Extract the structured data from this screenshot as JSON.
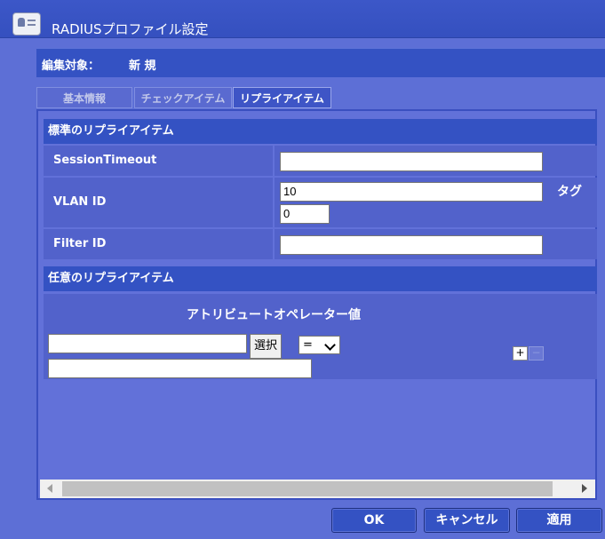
{
  "window": {
    "title": "RADIUSプロファイル設定",
    "icon": "profile-card-icon"
  },
  "edit_target": {
    "label": "編集対象：",
    "value": "新 規"
  },
  "tabs": [
    {
      "label": "基本情報",
      "active": false
    },
    {
      "label": "チェックアイテム",
      "active": false
    },
    {
      "label": "リプライアイテム",
      "active": true
    }
  ],
  "standard_section": {
    "title": "標準のリプライアイテム",
    "rows": [
      {
        "label": "SessionTimeout",
        "value": ""
      },
      {
        "label": "VLAN ID",
        "value": "10",
        "tag_value": "0",
        "tag_label": "タグ"
      },
      {
        "label": "Filter ID",
        "value": ""
      }
    ]
  },
  "optional_section": {
    "title": "任意のリプライアイテム",
    "column_header": "アトリビュートオペレーター値",
    "attribute_value": "",
    "select_button": "選択",
    "operator": "=",
    "value": "",
    "add_button": "+",
    "remove_button": "−"
  },
  "footer": {
    "ok": "OK",
    "cancel": "キャンセル",
    "apply": "適用"
  },
  "colors": {
    "background": "#5d6fd6",
    "header": "#3452c3",
    "row": "#5262cb"
  }
}
